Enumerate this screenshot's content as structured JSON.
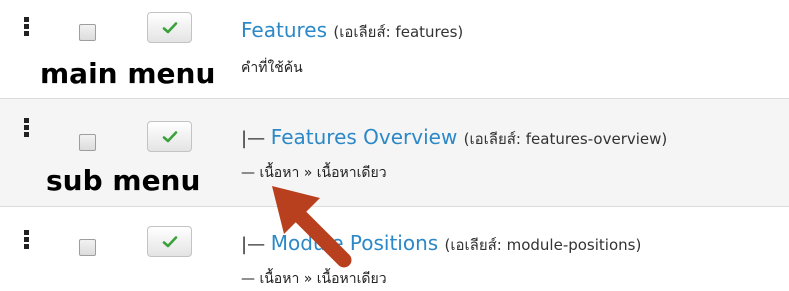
{
  "rows": [
    {
      "prefix": "",
      "title": "Features",
      "alias": "(เอเลียส์: features)",
      "subtitle": "คำที่ใช้ค้น"
    },
    {
      "prefix": "|— ",
      "title": "Features Overview",
      "alias": "(เอเลียส์: features-overview)",
      "subtitle": "— เนื้อหา » เนื้อหาเดียว"
    },
    {
      "prefix": "|— ",
      "title": "Module Positions",
      "alias": "(เอเลียส์: module-positions)",
      "subtitle": "— เนื้อหา » เนื้อหาเดียว"
    }
  ],
  "annotations": {
    "main_menu": "main menu",
    "sub_menu": "sub menu"
  },
  "colors": {
    "link": "#2c88c7",
    "check": "#3aa23a",
    "arrow": "#b9401f"
  },
  "icons": {
    "publish": "check-icon",
    "drag": "drag-handle-icon",
    "annotation": "arrow-icon"
  }
}
